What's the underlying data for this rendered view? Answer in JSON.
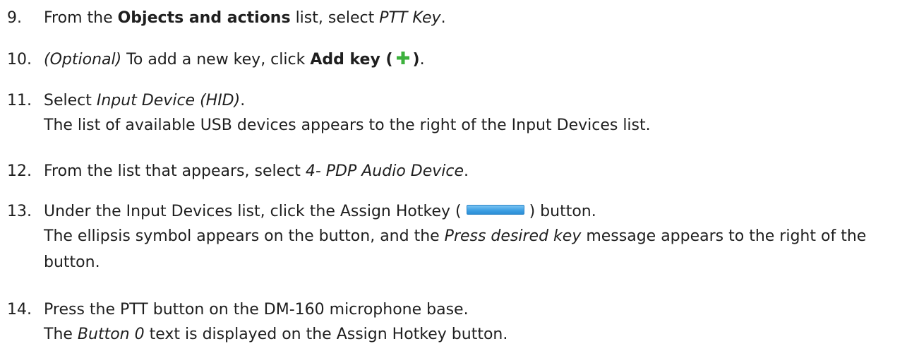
{
  "steps": [
    {
      "number": "9.",
      "pre": "From the ",
      "bold": "Objects and actions",
      "mid": " list, select ",
      "italic": "PTT Key",
      "post": "."
    },
    {
      "number": "10.",
      "optional": "(Optional)",
      "pre": " To add a new key, click ",
      "bold": "Add key (",
      "icon": "plus-icon",
      "bold_close": ")",
      "post": "."
    },
    {
      "number": "11.",
      "pre": "Select ",
      "italic": "Input Device (HID)",
      "post": ".",
      "result": "The list of available USB devices appears to the right of the Input Devices list."
    },
    {
      "number": "12.",
      "pre": "From the list that appears, select ",
      "italic": "4- PDP Audio Device",
      "post": "."
    },
    {
      "number": "13.",
      "pre": "Under the Input Devices list, click the Assign Hotkey (",
      "icon": "assign-hotkey-button-icon",
      "post": ") button.",
      "result_pre": "The ellipsis symbol appears on the button, and the ",
      "result_italic": "Press desired key",
      "result_post": " message appears to the right of the",
      "result_line2": "button."
    },
    {
      "number": "14.",
      "pre": "Press the PTT button on the DM-160 microphone base.",
      "result_pre": "The ",
      "result_italic": "Button 0",
      "result_post": " text is displayed on the Assign Hotkey button."
    }
  ],
  "colors": {
    "text": "#1f1f1f",
    "plus_icon": "#3db13d",
    "hotkey_button": "#3fa1e4"
  }
}
